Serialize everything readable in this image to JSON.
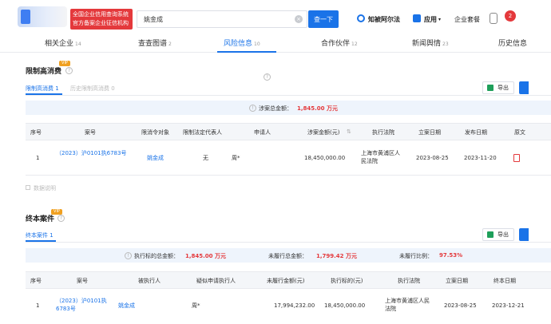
{
  "header": {
    "brand_badge": "全国企业信用查询系统 官方备案企业征信机构",
    "search_value": "姚金成",
    "search_button": "查一下",
    "nav": [
      {
        "label": "知被阿尔法"
      },
      {
        "label": "应用"
      },
      {
        "label": "企业套餐"
      }
    ],
    "avatar_badge": "2"
  },
  "tabs": [
    {
      "label": "相关企业",
      "count": "14"
    },
    {
      "label": "查查图谱",
      "count": "2"
    },
    {
      "label": "风险信息",
      "count": "10"
    },
    {
      "label": "合作伙伴",
      "count": "12"
    },
    {
      "label": "新闻舆情",
      "count": "23"
    },
    {
      "label": "历史信息",
      "count": ""
    }
  ],
  "consumption": {
    "vip": "VIP",
    "title": "限制高消费",
    "subtabs": [
      "限制高消费 1",
      "历史限制高消费 0"
    ],
    "export": "导出",
    "summary_label": "涉案总金额：",
    "summary_value": "1,845.00 万元",
    "columns": [
      "序号",
      "案号",
      "限消令对象",
      "限制法定代表人",
      "申请人",
      "涉案金额(元)",
      "执行法院",
      "立案日期",
      "发布日期",
      "原文"
    ],
    "rows": [
      {
        "index": "1",
        "case_no": "（2023）沪0101执6783号",
        "target": "姚金成",
        "legal_rep": "无",
        "applicant": "周*",
        "amount": "18,450,000.00",
        "court": "上海市黄浦区人民法院",
        "filed": "2023-08-25",
        "published": "2023-11-20"
      }
    ],
    "note": "数据说明"
  },
  "final_cases": {
    "vip": "VIP",
    "title": "终本案件",
    "subtabs": [
      "终本案件 1"
    ],
    "export": "导出",
    "summary": [
      {
        "label": "执行标的总金额：",
        "value": "1,845.00 万元"
      },
      {
        "label": "未履行总金额：",
        "value": "1,799.42 万元"
      },
      {
        "label": "未履行比例：",
        "value": "97.53%"
      }
    ],
    "columns": [
      "序号",
      "案号",
      "被执行人",
      "疑似申请执行人",
      "未履行金额(元)",
      "执行标的(元)",
      "执行法院",
      "立案日期",
      "终本日期"
    ],
    "rows": [
      {
        "index": "1",
        "case_no": "（2023）沪0101执6783号",
        "debtor": "姚金成",
        "applicant": "周*",
        "unpaid": "17,994,232.00",
        "target_amount": "18,450,000.00",
        "court": "上海市黄浦区人民法院",
        "filed": "2023-08-25",
        "ended": "2023-12-21"
      }
    ]
  },
  "colors": {
    "accent": "#1a73e8",
    "danger": "#e4393c",
    "vip": "#f0a020"
  }
}
